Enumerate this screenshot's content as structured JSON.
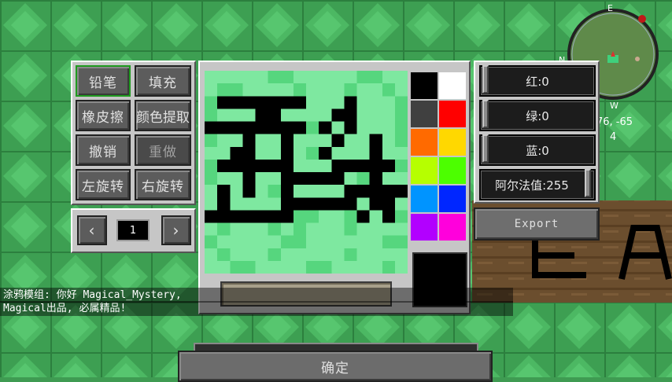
{
  "tools": {
    "pencil": "铅笔",
    "fill": "填充",
    "eraser": "橡皮擦",
    "eyedropper": "颜色提取",
    "undo": "撤销",
    "redo": "重做",
    "rotate_left": "左旋转",
    "rotate_right": "右旋转"
  },
  "pager": {
    "prev": "‹",
    "page": "1",
    "next": "›"
  },
  "sliders": {
    "red": "红:0",
    "green": "绿:0",
    "blue": "蓝:0",
    "alpha": "阿尔法值:255"
  },
  "slider_levels": {
    "red": 0,
    "green": 0,
    "blue": 0,
    "alpha": 255
  },
  "export_label": "Export",
  "confirm_label": "确定",
  "chat": {
    "line1": "涂鸦模组: 你好 Magical_Mystery,",
    "line2": " Magical出品, 必属精品!"
  },
  "minimap": {
    "north": "E",
    "south": "W",
    "west": "N",
    "coords": "76, -65",
    "extra": "4"
  },
  "palette": [
    "#000000",
    "#ffffff",
    "#404040",
    "#ff0000",
    "#ff6a00",
    "#ffd800",
    "#b6ff00",
    "#4cff00",
    "#0094ff",
    "#0026ff",
    "#b200ff",
    "#ff00dc"
  ],
  "current_color": "#000000",
  "colors": {
    "paint_black": "#000000",
    "emerald_light": "#7ee8a0",
    "emerald_mid": "#56d67e",
    "emerald_dark": "#2fb35a",
    "panel_gray": "#c6c6c6",
    "button_gray": "#5c5c5c"
  },
  "canvas_icons": {
    "canvas": "drawing-canvas",
    "name_field": "name-input"
  }
}
